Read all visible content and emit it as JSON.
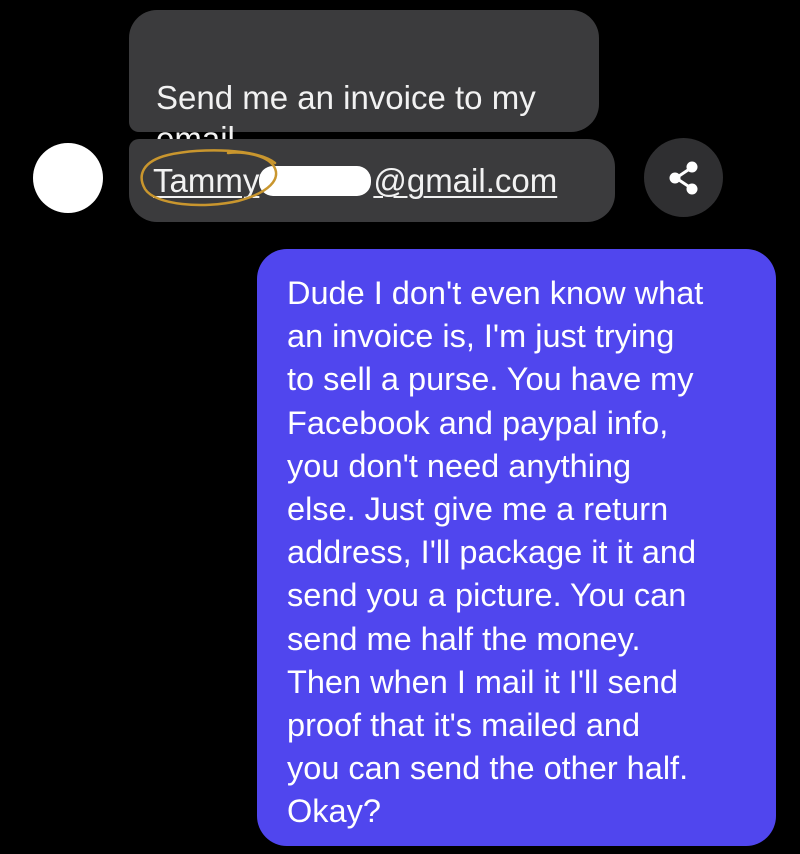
{
  "conversation": {
    "incoming": {
      "message_text": "Send me an invoice to my\nemail",
      "email": {
        "name_part": "Tammy",
        "domain_part": "@gmail.com"
      },
      "avatar_icon": "avatar-circle",
      "share_icon": "share-icon"
    },
    "outgoing": {
      "lines": [
        "Dude I don't even know what",
        "an invoice is, I'm just trying",
        "to sell a purse. You have my",
        "Facebook and paypal info,",
        "you don't need anything",
        "else. Just give me a return",
        "address, I'll package it it and",
        "send you a picture. You can",
        "send me half the money.",
        "Then when I mail it I'll send",
        "proof that it's mailed and",
        "you can send the other half.",
        "Okay?"
      ]
    }
  },
  "colors": {
    "background": "#000000",
    "incoming_bubble": "#3b3b3d",
    "outgoing_bubble": "#5046ee",
    "annotation_circle": "#c9962e"
  }
}
